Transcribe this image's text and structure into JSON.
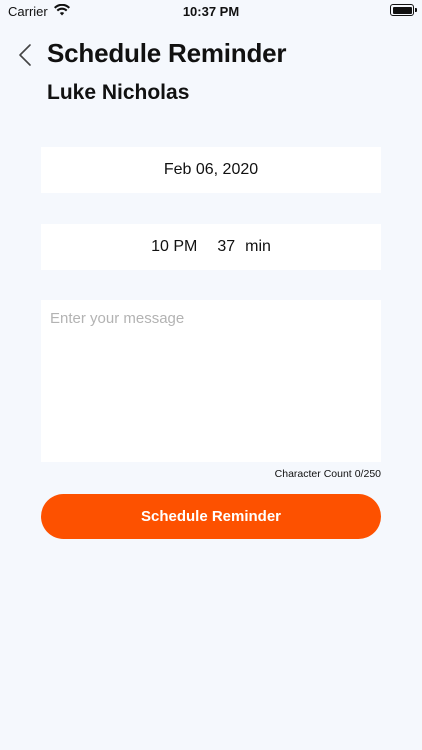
{
  "status_bar": {
    "carrier": "Carrier",
    "time": "10:37 PM",
    "icons": [
      "wifi-icon",
      "battery-icon"
    ]
  },
  "header": {
    "back_icon": "chevron-left-icon",
    "title": "Schedule Reminder",
    "contact_name": "Luke Nicholas"
  },
  "form": {
    "date": "Feb 06, 2020",
    "time": {
      "hour": "10 PM",
      "minute": "37",
      "minute_unit": "min"
    },
    "message": {
      "value": "",
      "placeholder": "Enter your message"
    },
    "character_count": {
      "label": "Character Count",
      "value": "0/250"
    },
    "submit_label": "Schedule Reminder"
  },
  "colors": {
    "background": "#f5f8fd",
    "accent": "#fd5100",
    "field": "#ffffff"
  }
}
